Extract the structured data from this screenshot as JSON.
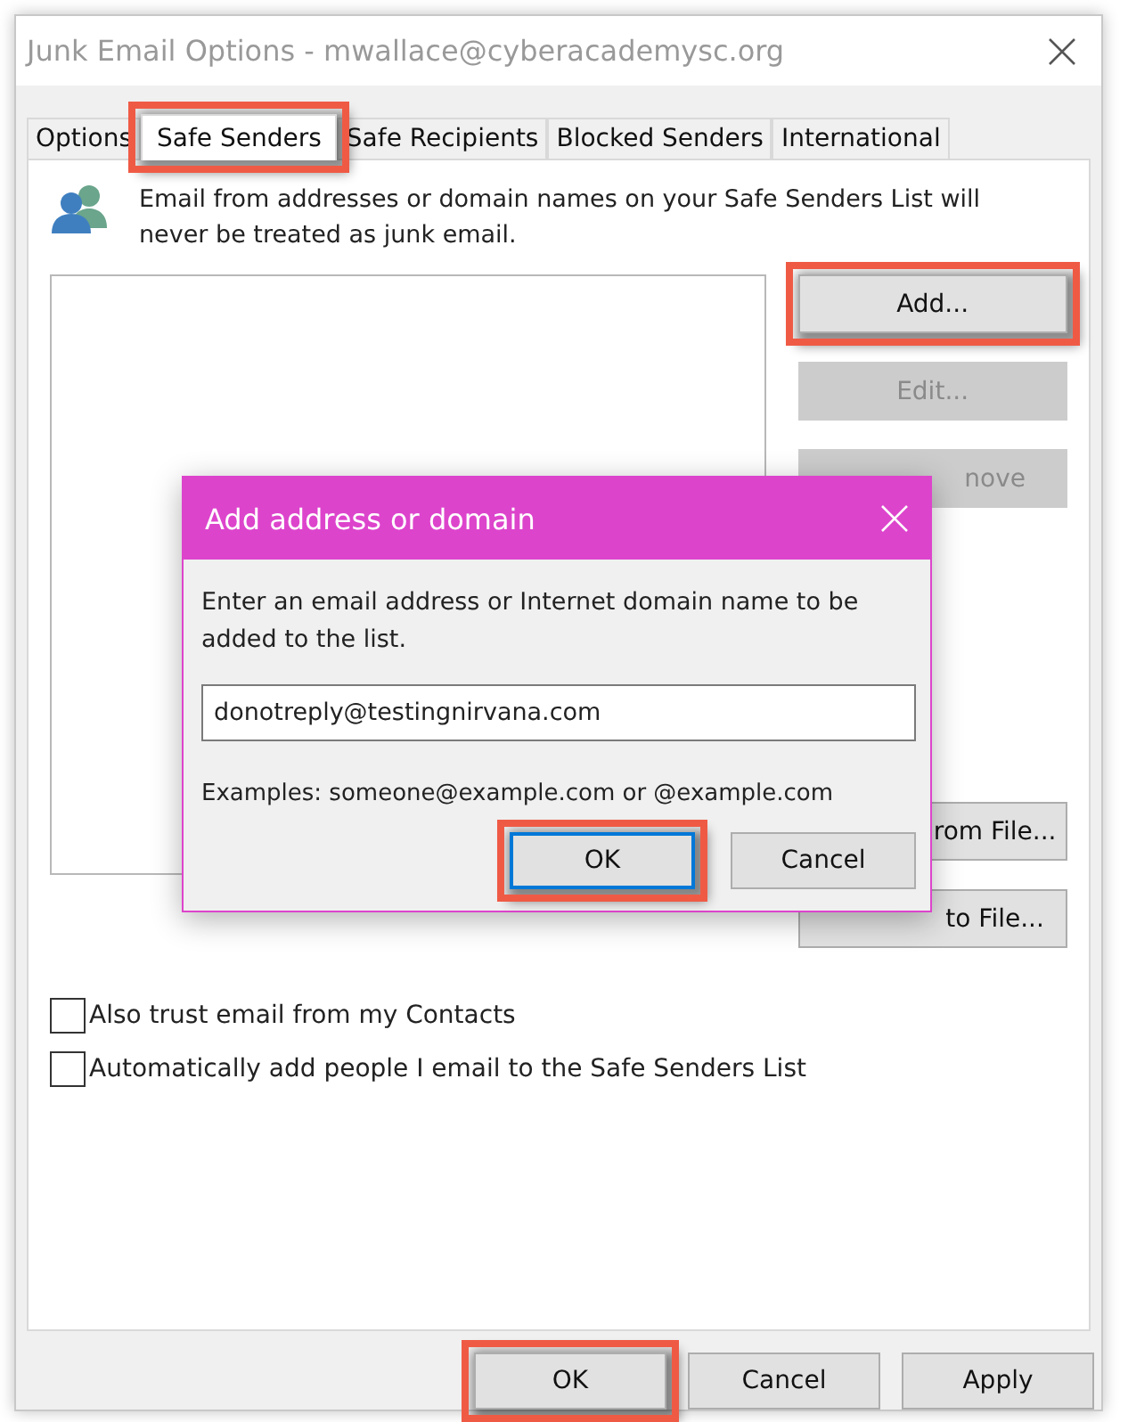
{
  "window": {
    "title": "Junk Email Options - mwallace@cyberacademysc.org"
  },
  "tabs": [
    {
      "label": "Options",
      "selected": false,
      "highlighted": false
    },
    {
      "label": "Safe Senders",
      "selected": true,
      "highlighted": true
    },
    {
      "label": "Safe Recipients",
      "selected": false,
      "highlighted": false
    },
    {
      "label": "Blocked Senders",
      "selected": false,
      "highlighted": false
    },
    {
      "label": "International",
      "selected": false,
      "highlighted": false
    }
  ],
  "description": "Email from addresses or domain names on your Safe Senders List will never be treated as junk email.",
  "side_buttons": [
    {
      "label": "Add...",
      "disabled": false,
      "highlighted": true,
      "covered": false
    },
    {
      "label": "Edit...",
      "disabled": true,
      "highlighted": false,
      "covered": false
    },
    {
      "label": "nove",
      "disabled": true,
      "highlighted": false,
      "covered": true
    },
    {
      "label": "rom File...",
      "disabled": false,
      "highlighted": false,
      "covered": true
    },
    {
      "label": "to File...",
      "disabled": false,
      "highlighted": false,
      "covered": true
    }
  ],
  "checkboxes": [
    {
      "label": "Also trust email from my Contacts",
      "checked": false
    },
    {
      "label": "Automatically add people I email to the Safe Senders List",
      "checked": false
    }
  ],
  "footer_buttons": [
    {
      "label": "OK",
      "highlighted": true
    },
    {
      "label": "Cancel",
      "highlighted": false
    },
    {
      "label": "Apply",
      "highlighted": false
    }
  ],
  "dialog": {
    "title": "Add address or domain",
    "prompt": "Enter an email address or Internet domain name to be added to the list.",
    "value": "donotreply@testingnirvana.com",
    "examples": "Examples: someone@example.com or @example.com",
    "buttons": [
      {
        "label": "OK",
        "highlighted": true,
        "focused": true
      },
      {
        "label": "Cancel",
        "highlighted": false,
        "focused": false
      }
    ]
  }
}
